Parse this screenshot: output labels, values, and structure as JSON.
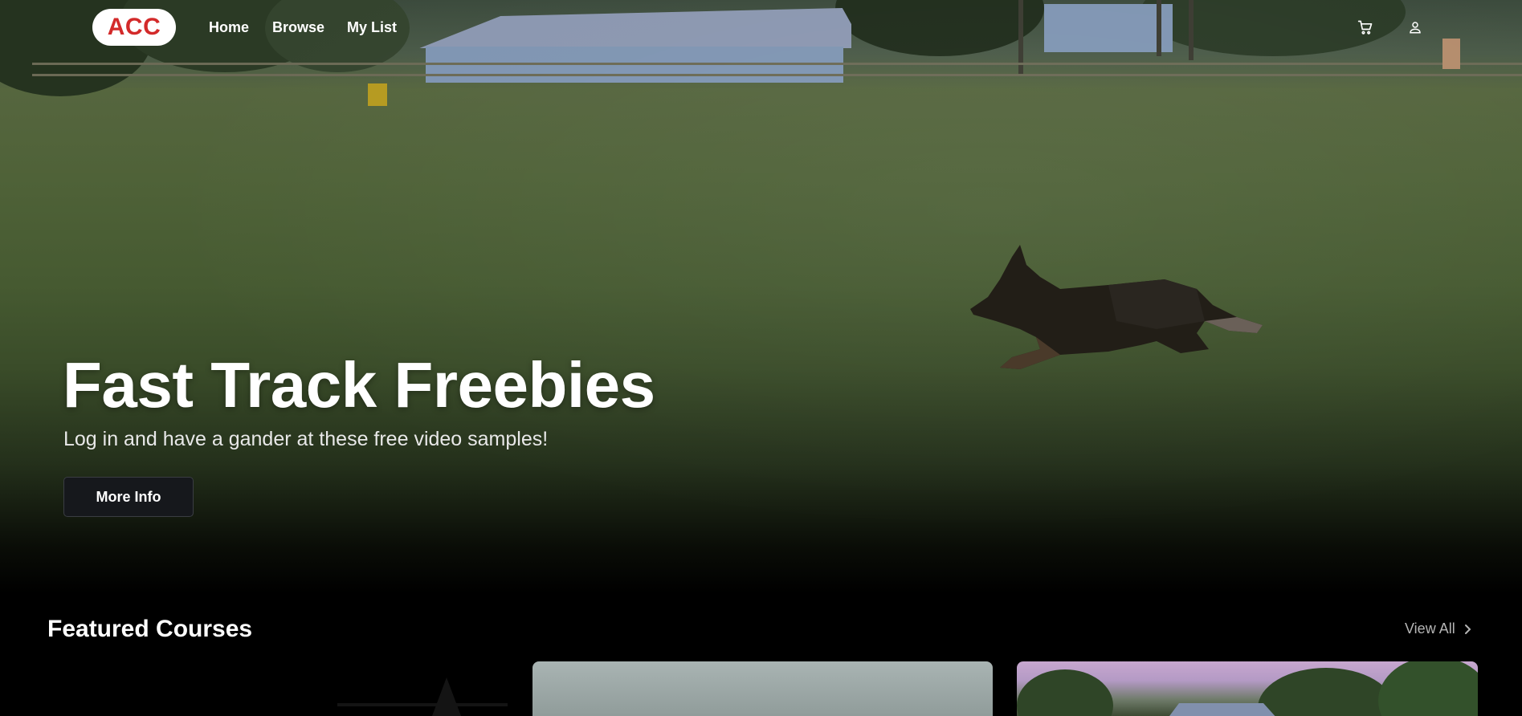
{
  "nav": {
    "logo": "ACC",
    "links": [
      "Home",
      "Browse",
      "My List"
    ],
    "icons": [
      "cart-icon",
      "user-icon"
    ]
  },
  "hero": {
    "title": "Fast Track Freebies",
    "subtitle": "Log in and have a gander at these free video samples!",
    "button_label": "More Info"
  },
  "featured": {
    "title": "Featured Courses",
    "view_all_label": "View All"
  },
  "colors": {
    "logo_red": "#d32a2a",
    "background": "#000000",
    "button_bg": "#16181c",
    "muted_text": "#b5b5b5"
  }
}
